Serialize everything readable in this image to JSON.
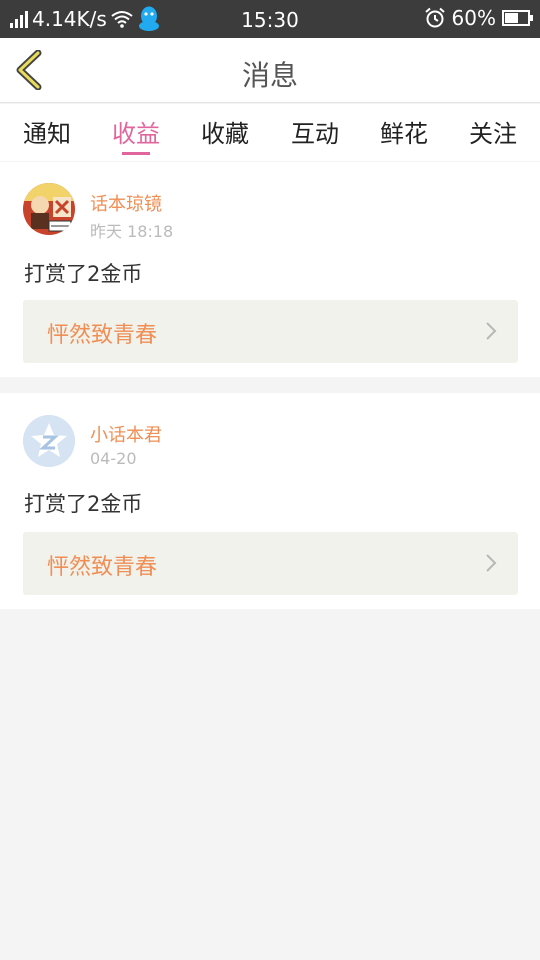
{
  "status_bar": {
    "net_speed": "4.14K/s",
    "time": "15:30",
    "battery": "60%",
    "battery_level": 0.6,
    "icons": [
      "signal-icon",
      "wifi-icon",
      "qq-icon",
      "alarm-icon",
      "battery-icon"
    ]
  },
  "nav": {
    "title": "消息",
    "back_icon": "back-chevron-icon"
  },
  "tabs": [
    {
      "label": "通知",
      "active": false
    },
    {
      "label": "收益",
      "active": true
    },
    {
      "label": "收藏",
      "active": false
    },
    {
      "label": "互动",
      "active": false
    },
    {
      "label": "鲜花",
      "active": false
    },
    {
      "label": "关注",
      "active": false
    }
  ],
  "messages": [
    {
      "username": "话本琼镜",
      "time": "昨天 18:18",
      "text": "打赏了2金币",
      "link": "怦然致青春",
      "avatar": "custom-avatar"
    },
    {
      "username": "小话本君",
      "time": "04-20",
      "text": "打赏了2金币",
      "link": "怦然致青春",
      "avatar": "default-avatar"
    }
  ],
  "colors": {
    "accent": "#e0669d",
    "name": "#ef8f55",
    "status_bar": "#3c3c3c"
  }
}
